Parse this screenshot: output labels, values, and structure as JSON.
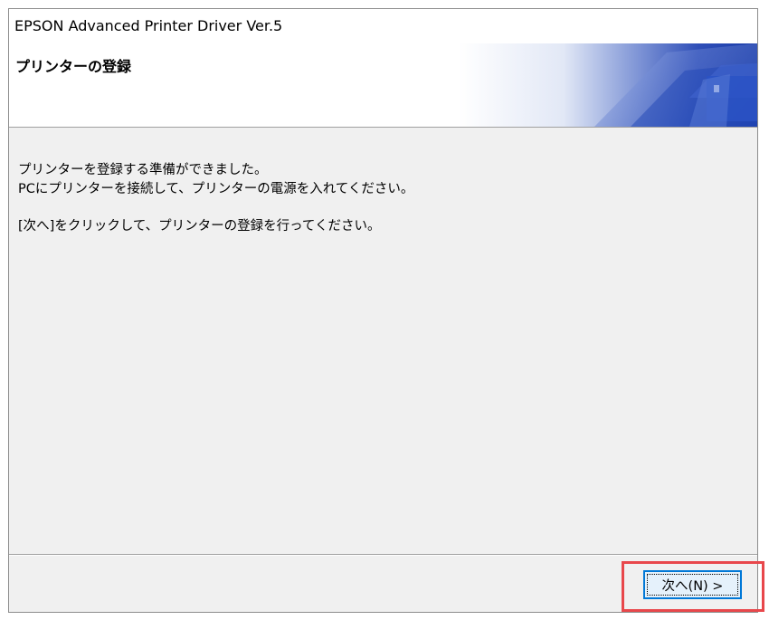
{
  "window": {
    "title": "EPSON Advanced Printer Driver Ver.5"
  },
  "header": {
    "title": "プリンターの登録"
  },
  "content": {
    "line1": "プリンターを登録する準備ができました。",
    "line2": "PCにプリンターを接続して、プリンターの電源を入れてください。",
    "line3": "[次へ]をクリックして、プリンターの登録を行ってください。"
  },
  "footer": {
    "next_label": "次へ(N) >"
  },
  "colors": {
    "accent": "#0078d7",
    "highlight": "#e8474b",
    "dialog_bg": "#f0f0f0"
  },
  "icons": {
    "banner": "printer-graphic-icon"
  }
}
